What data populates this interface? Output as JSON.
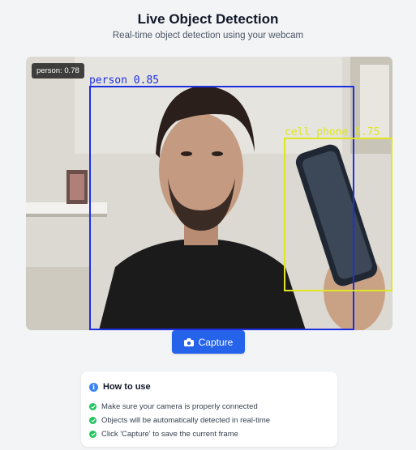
{
  "header": {
    "title": "Live Object Detection",
    "subtitle": "Real-time object detection using your webcam"
  },
  "video": {
    "overlay_badge": "person: 0.78",
    "detections": [
      {
        "label": "person 0.85",
        "color": "#1d2fe0"
      },
      {
        "label": "cell phone 0.75",
        "color": "#dfe61f"
      }
    ]
  },
  "capture": {
    "label": "Capture",
    "icon": "camera-icon",
    "color": "#2563eb"
  },
  "howto": {
    "title": "How to use",
    "icon": "info-icon",
    "items": [
      "Make sure your camera is properly connected",
      "Objects will be automatically detected in real-time",
      "Click 'Capture' to save the current frame"
    ]
  }
}
